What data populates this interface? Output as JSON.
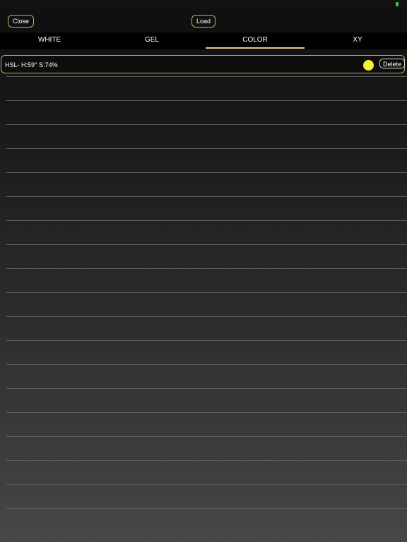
{
  "topbar": {
    "close_label": "Close",
    "load_label": "Load"
  },
  "tabs": [
    {
      "label": "WHITE",
      "active": false
    },
    {
      "label": "GEL",
      "active": false
    },
    {
      "label": "COLOR",
      "active": true
    },
    {
      "label": "XY",
      "active": false
    }
  ],
  "colors": {
    "accent": "#c9a962",
    "tab_indicator": "#e3cc98",
    "battery": "#34c759"
  },
  "list": {
    "items": [
      {
        "label": "HSL- H:59° S:74%",
        "swatch_color": "#f4f03a",
        "delete_label": "Delete"
      }
    ],
    "empty_row_count": 19
  }
}
